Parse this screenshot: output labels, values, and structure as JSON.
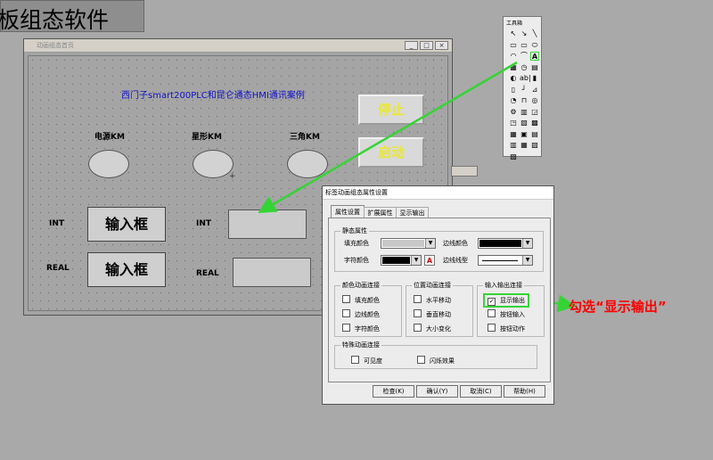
{
  "banner": "板组态软件",
  "hmi_window": {
    "title": "动画组态首页",
    "heading": "西门子smart200PLC和昆仑通态HMI通讯案例",
    "lamp_labels": [
      "电源KM",
      "星形KM",
      "三角KM"
    ],
    "stop_label": "停止",
    "start_label": "启动",
    "int_label": "INT",
    "real_label": "REAL",
    "input_box_label": "输入框"
  },
  "toolbox": {
    "title": "工具箱",
    "tools": [
      "↖",
      "↘",
      "╲",
      "▭",
      "▭",
      "⬭",
      "◠",
      "⌒",
      "A",
      "▦",
      "◷",
      "▤",
      "◐",
      "ab|",
      "▮",
      "▯",
      "┘",
      "⊿",
      "◔",
      "⊓",
      "◎",
      "⚙",
      "▥",
      "◲",
      "◳",
      "▧",
      "▩",
      "▦",
      "▣",
      "▤",
      "▥",
      "▦",
      "▧",
      "▨"
    ]
  },
  "dialog": {
    "title": "标签动画组态属性设置",
    "tabs": [
      "属性设置",
      "扩展属性",
      "显示输出"
    ],
    "static_group": "静态属性",
    "fill_color": "填充颜色",
    "border_color": "边线颜色",
    "char_color": "字符颜色",
    "border_style": "边线线型",
    "color_anim_group": "颜色动画连接",
    "color_anim_items": [
      "填充颜色",
      "边线颜色",
      "字符颜色"
    ],
    "pos_anim_group": "位置动画连接",
    "pos_anim_items": [
      "水平移动",
      "垂直移动",
      "大小变化"
    ],
    "io_group": "输入输出连接",
    "io_items": [
      "显示输出",
      "按钮输入",
      "按钮动作"
    ],
    "special_group": "特殊动画连接",
    "special_items": [
      "可见度",
      "闪烁效果"
    ],
    "buttons": [
      "检查(K)",
      "确认(Y)",
      "取消(C)",
      "帮助(H)"
    ],
    "fill_color_value": "#c8c8c8",
    "border_color_value": "#000000",
    "char_color_value": "#000000"
  },
  "annotation": "勾选“显示输出”",
  "colors": {
    "arrow": "#35d435",
    "annotation": "#ff0000",
    "button_text": "#e8e838",
    "heading": "#1010c8"
  }
}
